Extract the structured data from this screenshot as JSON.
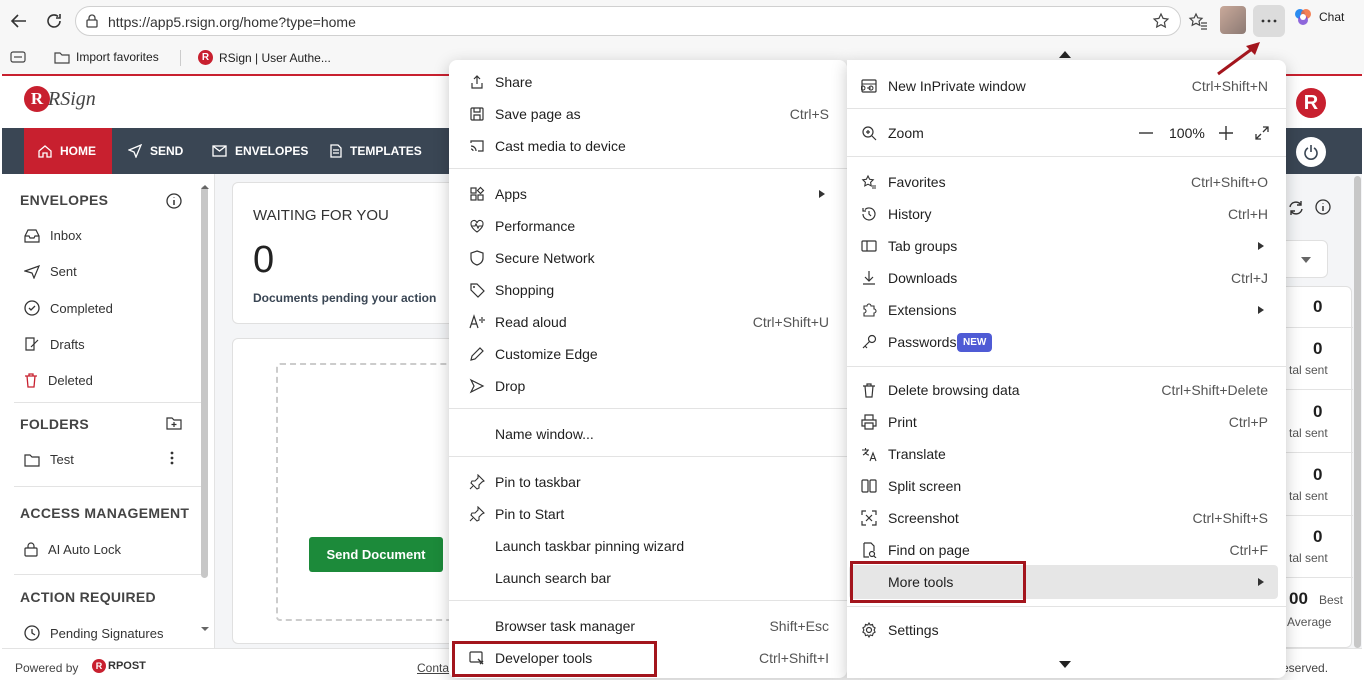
{
  "browser": {
    "url": "https://app5.rsign.org/home?type=home",
    "chat_label": "Chat",
    "bookmarks": [
      "Import favorites",
      "RSign | User Authe..."
    ]
  },
  "app": {
    "logo_text": "RSign",
    "nav": [
      "HOME",
      "SEND",
      "ENVELOPES",
      "TEMPLATES"
    ],
    "sidebar": {
      "envelopes_header": "ENVELOPES",
      "envelope_items": [
        "Inbox",
        "Sent",
        "Completed",
        "Drafts",
        "Deleted"
      ],
      "folders_header": "FOLDERS",
      "folder_items": [
        "Test"
      ],
      "access_header": "ACCESS MANAGEMENT",
      "access_items": [
        "AI Auto Lock"
      ],
      "action_header": "ACTION REQUIRED",
      "action_items": [
        "Pending Signatures"
      ]
    },
    "waiting": {
      "title": "WAITING FOR YOU",
      "count": "0",
      "caption": "Documents pending your action"
    },
    "send_button": "Send Document",
    "stats": [
      {
        "value": "0",
        "label": ""
      },
      {
        "value": "0",
        "label": "tal sent"
      },
      {
        "value": "0",
        "label": "tal sent"
      },
      {
        "value": "0",
        "label": "tal sent"
      },
      {
        "value": "0",
        "label": "tal sent"
      }
    ],
    "best_value": "00",
    "best_label": "Best",
    "average_label": "Average",
    "footer": {
      "powered_by": "Powered by",
      "brand": "RPOST",
      "contact": "Conta",
      "reserved": "reserved."
    }
  },
  "more_tools_menu": [
    {
      "label": "Share",
      "shortcut": "",
      "icon": "share-icon"
    },
    {
      "label": "Save page as",
      "shortcut": "Ctrl+S",
      "icon": "save-page-icon"
    },
    {
      "label": "Cast media to device",
      "shortcut": "",
      "icon": "cast-icon"
    },
    {
      "label": "Apps",
      "shortcut": "",
      "icon": "apps-icon",
      "submenu": true
    },
    {
      "label": "Performance",
      "shortcut": "",
      "icon": "performance-icon"
    },
    {
      "label": "Secure Network",
      "shortcut": "",
      "icon": "shield-icon"
    },
    {
      "label": "Shopping",
      "shortcut": "",
      "icon": "tag-icon"
    },
    {
      "label": "Read aloud",
      "shortcut": "Ctrl+Shift+U",
      "icon": "read-aloud-icon"
    },
    {
      "label": "Customize Edge",
      "shortcut": "",
      "icon": "pen-icon"
    },
    {
      "label": "Drop",
      "shortcut": "",
      "icon": "drop-icon"
    },
    {
      "label": "Name window...",
      "shortcut": "",
      "icon": ""
    },
    {
      "label": "Pin to taskbar",
      "shortcut": "",
      "icon": "pin-icon"
    },
    {
      "label": "Pin to Start",
      "shortcut": "",
      "icon": "pin-icon"
    },
    {
      "label": "Launch taskbar pinning wizard",
      "shortcut": "",
      "icon": ""
    },
    {
      "label": "Launch search bar",
      "shortcut": "",
      "icon": ""
    },
    {
      "label": "Browser task manager",
      "shortcut": "Shift+Esc",
      "icon": ""
    },
    {
      "label": "Developer tools",
      "shortcut": "Ctrl+Shift+I",
      "icon": "developer-tools-icon"
    }
  ],
  "main_menu": [
    {
      "label": "New InPrivate window",
      "shortcut": "Ctrl+Shift+N",
      "icon": "inprivate-icon"
    },
    {
      "label": "Zoom",
      "shortcut": "",
      "icon": "zoom-icon",
      "zoom_value": "100%"
    },
    {
      "label": "Favorites",
      "shortcut": "Ctrl+Shift+O",
      "icon": "favorites-icon"
    },
    {
      "label": "History",
      "shortcut": "Ctrl+H",
      "icon": "history-icon"
    },
    {
      "label": "Tab groups",
      "shortcut": "",
      "icon": "tab-groups-icon",
      "submenu": true
    },
    {
      "label": "Downloads",
      "shortcut": "Ctrl+J",
      "icon": "download-icon"
    },
    {
      "label": "Extensions",
      "shortcut": "",
      "icon": "extensions-icon",
      "submenu": true
    },
    {
      "label": "Passwords",
      "shortcut": "",
      "icon": "key-icon",
      "badge": "NEW"
    },
    {
      "label": "Delete browsing data",
      "shortcut": "Ctrl+Shift+Delete",
      "icon": "trash-icon"
    },
    {
      "label": "Print",
      "shortcut": "Ctrl+P",
      "icon": "print-icon"
    },
    {
      "label": "Translate",
      "shortcut": "",
      "icon": "translate-icon"
    },
    {
      "label": "Split screen",
      "shortcut": "",
      "icon": "split-screen-icon"
    },
    {
      "label": "Screenshot",
      "shortcut": "Ctrl+Shift+S",
      "icon": "screenshot-icon"
    },
    {
      "label": "Find on page",
      "shortcut": "Ctrl+F",
      "icon": "find-icon"
    },
    {
      "label": "More tools",
      "shortcut": "",
      "icon": "",
      "submenu": true
    },
    {
      "label": "Settings",
      "shortcut": "",
      "icon": "gear-icon"
    }
  ],
  "colors": {
    "highlight": "#a3151d",
    "nav_bg": "#3a4654",
    "home_active": "#c8202f",
    "send_green": "#1c8a3a",
    "new_badge": "#4f5bd5"
  }
}
